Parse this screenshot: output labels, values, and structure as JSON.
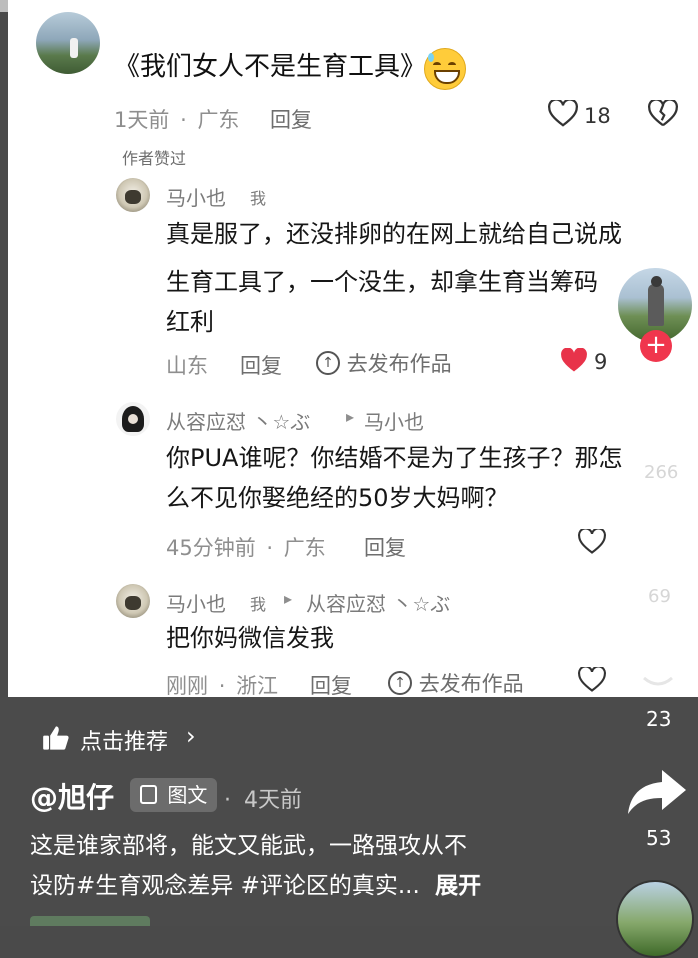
{
  "comment_main": {
    "text": "《我们女人不是生育工具》",
    "emoji": "😅",
    "time": "1天前",
    "dot": "·",
    "location": "广东",
    "reply": "回复",
    "likes": "18",
    "author_liked": "作者赞过"
  },
  "reply1": {
    "name": "马小也",
    "me": "我",
    "text_line1": "真是服了，还没排卵的在网上就给自己说成",
    "text_line2": "生育工具了，一个没生，却拿生育当筹码",
    "text_line3": "红利",
    "location": "山东",
    "reply": "回复",
    "publish": "去发布作品",
    "likes": "9"
  },
  "reply2": {
    "name": "从容应怼 丶☆ぶ",
    "arrow": "▸",
    "to": "马小也",
    "text_line1": "你PUA谁呢？你结婚不是为了生孩子？那怎",
    "text_line2": "么不见你娶绝经的50岁大妈啊？",
    "time": "45分钟前",
    "dot": "·",
    "location": "广东",
    "reply": "回复"
  },
  "reply3": {
    "name": "马小也",
    "me": "我",
    "arrow": "▸",
    "to": "从容应怼 丶☆ぶ",
    "text": "把你妈微信发我",
    "time": "刚刚",
    "dot": "·",
    "location": "浙江",
    "reply": "回复",
    "publish": "去发布作品"
  },
  "side": {
    "ghost_top": "266",
    "ghost_mid": "69",
    "comment_count": "23",
    "share_count": "53"
  },
  "bottom": {
    "recommend": "点击推荐",
    "author": "@旭仔",
    "type_badge": "图文",
    "dot": "·",
    "posted": "4天前",
    "desc_line1": "这是谁家部将，能文又能武，一路强攻从不",
    "desc_line2": "设防#生育观念差异 #评论区的真实...",
    "expand": "展开"
  },
  "colors": {
    "like_red": "#e8334a",
    "follow_red": "#f0364d",
    "overlay_gray": "#4b4b4b"
  }
}
